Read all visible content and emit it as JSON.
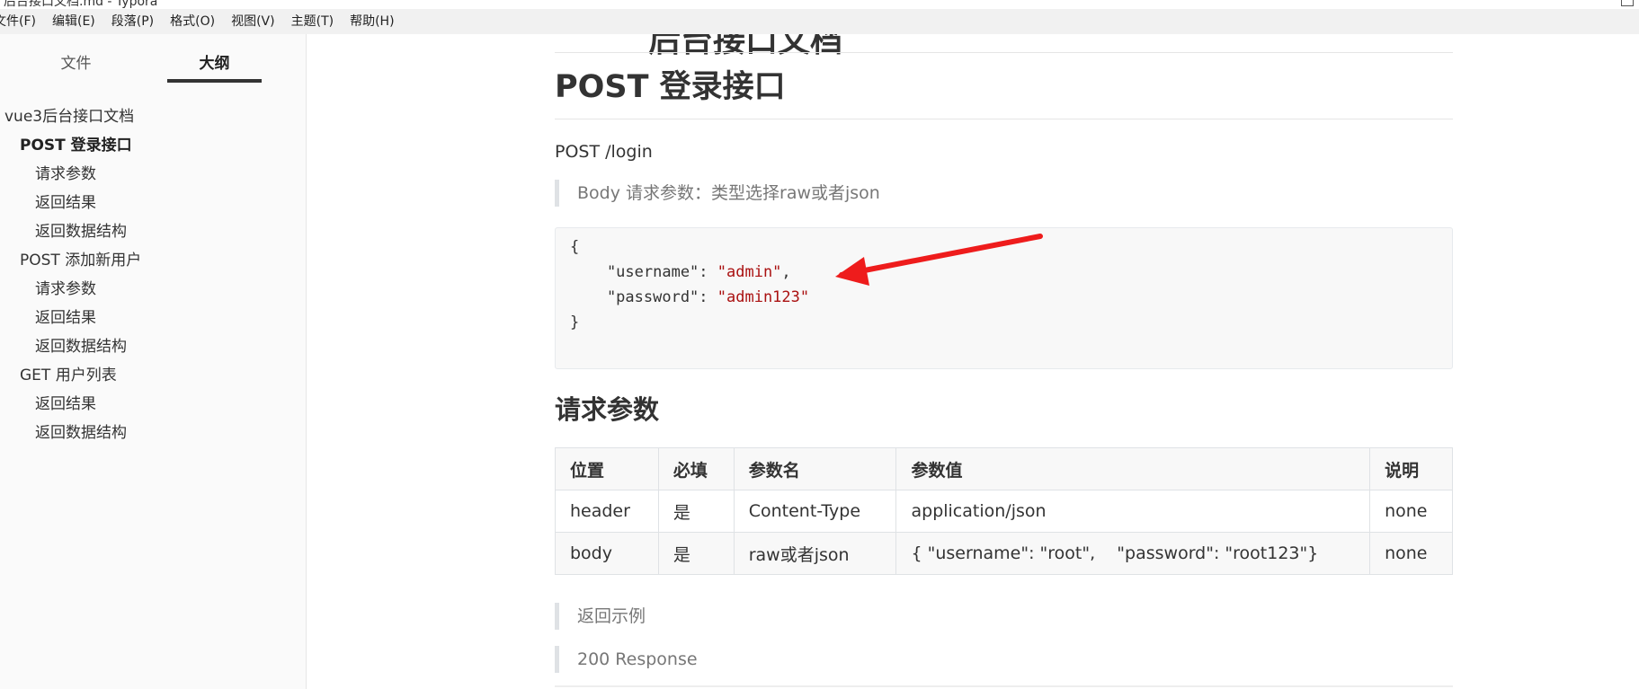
{
  "window": {
    "title": "后台接口文档.md - Typora"
  },
  "menubar": {
    "items": [
      "文件(F)",
      "编辑(E)",
      "段落(P)",
      "格式(O)",
      "视图(V)",
      "主题(T)",
      "帮助(H)"
    ]
  },
  "sidebar": {
    "tabs": {
      "files": "文件",
      "outline": "大纲"
    },
    "active_tab": "outline",
    "outline": [
      {
        "label": "vue3后台接口文档",
        "level": 1,
        "active": false
      },
      {
        "label": "POST 登录接口",
        "level": 2,
        "active": true
      },
      {
        "label": "请求参数",
        "level": 3,
        "active": false
      },
      {
        "label": "返回结果",
        "level": 3,
        "active": false
      },
      {
        "label": "返回数据结构",
        "level": 3,
        "active": false
      },
      {
        "label": "POST 添加新用户",
        "level": 2,
        "active": false
      },
      {
        "label": "请求参数",
        "level": 3,
        "active": false
      },
      {
        "label": "返回结果",
        "level": 3,
        "active": false
      },
      {
        "label": "返回数据结构",
        "level": 3,
        "active": false
      },
      {
        "label": "GET 用户列表",
        "level": 2,
        "active": false
      },
      {
        "label": "返回结果",
        "level": 3,
        "active": false
      },
      {
        "label": "返回数据结构",
        "level": 3,
        "active": false
      }
    ]
  },
  "document": {
    "h1_partial": "后台接口文档",
    "section_title": "POST 登录接口",
    "endpoint": "POST /login",
    "body_note": "Body 请求参数：类型选择raw或者json",
    "code": {
      "open": "{",
      "line1_key": "    \"username\": ",
      "line1_value": "\"admin\"",
      "line1_suffix": ",",
      "line2_key": "    \"password\": ",
      "line2_value": "\"admin123\"",
      "close": "}"
    },
    "params_heading": "请求参数",
    "table": {
      "headers": [
        "位置",
        "必填",
        "参数名",
        "参数值",
        "说明"
      ],
      "rows": [
        [
          "header",
          "是",
          "Content-Type",
          "application/json",
          "none"
        ],
        [
          "body",
          "是",
          "raw或者json",
          "{ \"username\": \"root\",    \"password\": \"root123\"}",
          "none"
        ]
      ]
    },
    "return_example": "返回示例",
    "response_code": "200 Response"
  },
  "colors": {
    "menubar_bg": "#f1f1f1",
    "sidebar_bg": "#fafafa",
    "code_string": "#aa1111",
    "annotation_arrow": "#ee1c1c",
    "quote_bar": "#dfe2e5"
  }
}
